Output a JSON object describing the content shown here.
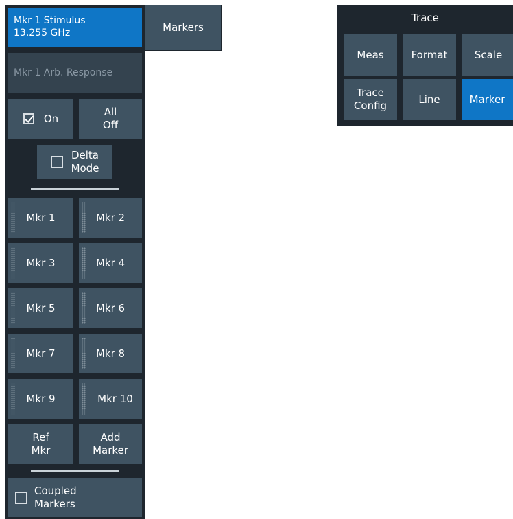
{
  "markers_panel": {
    "stimulus": {
      "line1": "Mkr 1 Stimulus",
      "line2": "13.255 GHz"
    },
    "arb_response": "Mkr 1 Arb. Response",
    "on": {
      "label": "On",
      "checked": true
    },
    "all_off": {
      "line1": "All",
      "line2": "Off"
    },
    "delta_mode": {
      "line1": "Delta",
      "line2": "Mode",
      "checked": false
    },
    "markers": [
      "Mkr 1",
      "Mkr 2",
      "Mkr 3",
      "Mkr 4",
      "Mkr 5",
      "Mkr 6",
      "Mkr 7",
      "Mkr 8",
      "Mkr 9",
      "Mkr 10"
    ],
    "ref_mkr": {
      "line1": "Ref",
      "line2": "Mkr"
    },
    "add_marker": {
      "line1": "Add",
      "line2": "Marker"
    },
    "coupled_markers": {
      "line1": "Coupled",
      "line2": "Markers",
      "checked": false
    }
  },
  "tab": {
    "label": "Markers"
  },
  "trace_panel": {
    "title": "Trace",
    "buttons": {
      "meas": "Meas",
      "format": "Format",
      "scale": "Scale",
      "trace_config": {
        "line1": "Trace",
        "line2": "Config"
      },
      "line": "Line",
      "marker": "Marker"
    },
    "active": "Marker"
  },
  "colors": {
    "panel_bg": "#1e262e",
    "button": "#3f5362",
    "accent": "#0f76c6",
    "disabled_text": "#8a98a4"
  }
}
